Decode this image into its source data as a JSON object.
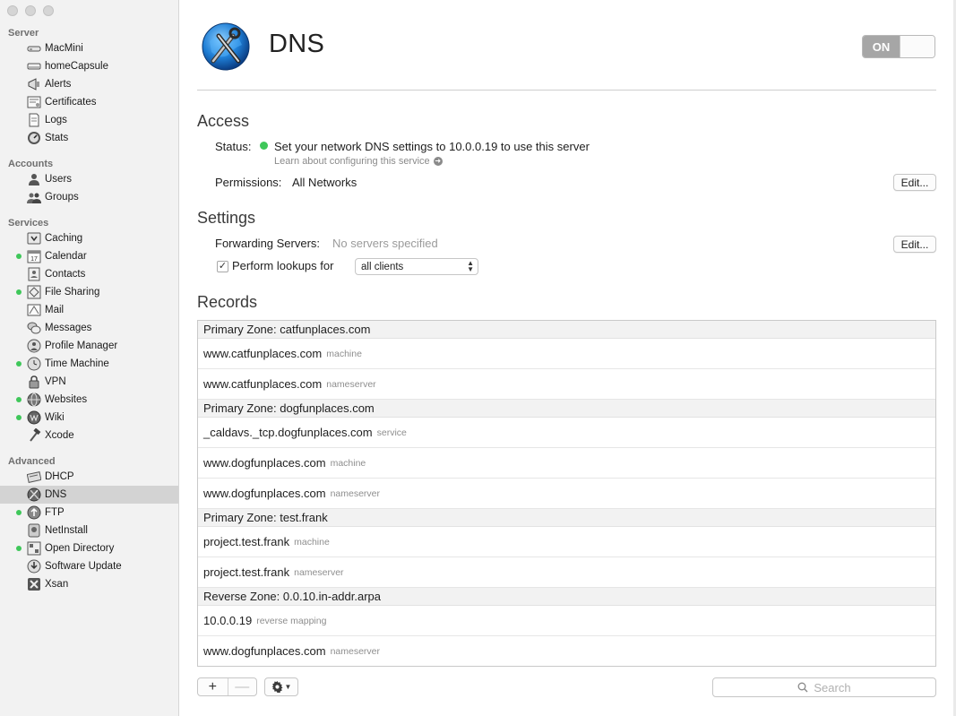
{
  "sidebar": {
    "sections": {
      "server": "Server",
      "accounts": "Accounts",
      "services": "Services",
      "advanced": "Advanced"
    },
    "server_items": [
      {
        "label": "MacMini",
        "icon": "mac-mini-icon",
        "dot": false
      },
      {
        "label": "homeCapsule",
        "icon": "time-capsule-icon",
        "dot": false
      },
      {
        "label": "Alerts",
        "icon": "megaphone-icon",
        "dot": false
      },
      {
        "label": "Certificates",
        "icon": "certificate-icon",
        "dot": false
      },
      {
        "label": "Logs",
        "icon": "log-document-icon",
        "dot": false
      },
      {
        "label": "Stats",
        "icon": "gauge-icon",
        "dot": false
      }
    ],
    "account_items": [
      {
        "label": "Users",
        "icon": "user-icon",
        "dot": false
      },
      {
        "label": "Groups",
        "icon": "group-icon",
        "dot": false
      }
    ],
    "service_items": [
      {
        "label": "Caching",
        "icon": "caching-icon",
        "dot": false
      },
      {
        "label": "Calendar",
        "icon": "calendar-icon",
        "dot": true
      },
      {
        "label": "Contacts",
        "icon": "contacts-icon",
        "dot": false
      },
      {
        "label": "File Sharing",
        "icon": "file-sharing-icon",
        "dot": true
      },
      {
        "label": "Mail",
        "icon": "mail-icon",
        "dot": false
      },
      {
        "label": "Messages",
        "icon": "messages-icon",
        "dot": false
      },
      {
        "label": "Profile Manager",
        "icon": "profile-manager-icon",
        "dot": false
      },
      {
        "label": "Time Machine",
        "icon": "time-machine-icon",
        "dot": true
      },
      {
        "label": "VPN",
        "icon": "lock-icon",
        "dot": false
      },
      {
        "label": "Websites",
        "icon": "globe-icon",
        "dot": true
      },
      {
        "label": "Wiki",
        "icon": "wiki-icon",
        "dot": true
      },
      {
        "label": "Xcode",
        "icon": "hammer-icon",
        "dot": false
      }
    ],
    "advanced_items": [
      {
        "label": "DHCP",
        "icon": "dhcp-icon",
        "dot": false
      },
      {
        "label": "DNS",
        "icon": "dns-icon",
        "dot": false,
        "selected": true
      },
      {
        "label": "FTP",
        "icon": "ftp-icon",
        "dot": true
      },
      {
        "label": "NetInstall",
        "icon": "netinstall-icon",
        "dot": false
      },
      {
        "label": "Open Directory",
        "icon": "open-directory-icon",
        "dot": true
      },
      {
        "label": "Software Update",
        "icon": "software-update-icon",
        "dot": false
      },
      {
        "label": "Xsan",
        "icon": "xsan-icon",
        "dot": false
      }
    ]
  },
  "header": {
    "title": "DNS",
    "toggle_label": "ON",
    "icon": "dns-globe-tools-icon"
  },
  "access": {
    "heading": "Access",
    "status_label": "Status:",
    "status_text": "Set your network DNS settings to 10.0.0.19 to use this server",
    "learn_link": "Learn about configuring this service",
    "permissions_label": "Permissions:",
    "permissions_value": "All Networks",
    "edit_button": "Edit..."
  },
  "settings": {
    "heading": "Settings",
    "forwarding_label": "Forwarding Servers:",
    "forwarding_value": "No servers specified",
    "edit_button": "Edit...",
    "lookups_checked": true,
    "lookups_label": "Perform lookups for",
    "lookups_selected": "all clients"
  },
  "records": {
    "heading": "Records",
    "rows": [
      {
        "kind": "zone",
        "text": "Primary Zone: catfunplaces.com"
      },
      {
        "kind": "record",
        "name": "www.catfunplaces.com",
        "type": "machine"
      },
      {
        "kind": "record",
        "name": "www.catfunplaces.com",
        "type": "nameserver"
      },
      {
        "kind": "zone",
        "text": "Primary Zone: dogfunplaces.com"
      },
      {
        "kind": "record",
        "name": "_caldavs._tcp.dogfunplaces.com",
        "type": "service"
      },
      {
        "kind": "record",
        "name": "www.dogfunplaces.com",
        "type": "machine"
      },
      {
        "kind": "record",
        "name": "www.dogfunplaces.com",
        "type": "nameserver"
      },
      {
        "kind": "zone",
        "text": "Primary Zone: test.frank"
      },
      {
        "kind": "record",
        "name": "project.test.frank",
        "type": "machine"
      },
      {
        "kind": "record",
        "name": "project.test.frank",
        "type": "nameserver"
      },
      {
        "kind": "zone",
        "text": "Reverse Zone: 0.0.10.in-addr.arpa"
      },
      {
        "kind": "record",
        "name": "10.0.0.19",
        "type": "reverse mapping"
      },
      {
        "kind": "record",
        "name": "www.dogfunplaces.com",
        "type": "nameserver"
      }
    ]
  },
  "toolbar": {
    "add": "+",
    "remove": "—",
    "search_placeholder": "Search"
  },
  "colors": {
    "status_green": "#3fc75a",
    "sidebar_bg": "#f2f2f2",
    "selected_bg": "#d3d3d3",
    "toggle_on": "#a6a6a6"
  }
}
